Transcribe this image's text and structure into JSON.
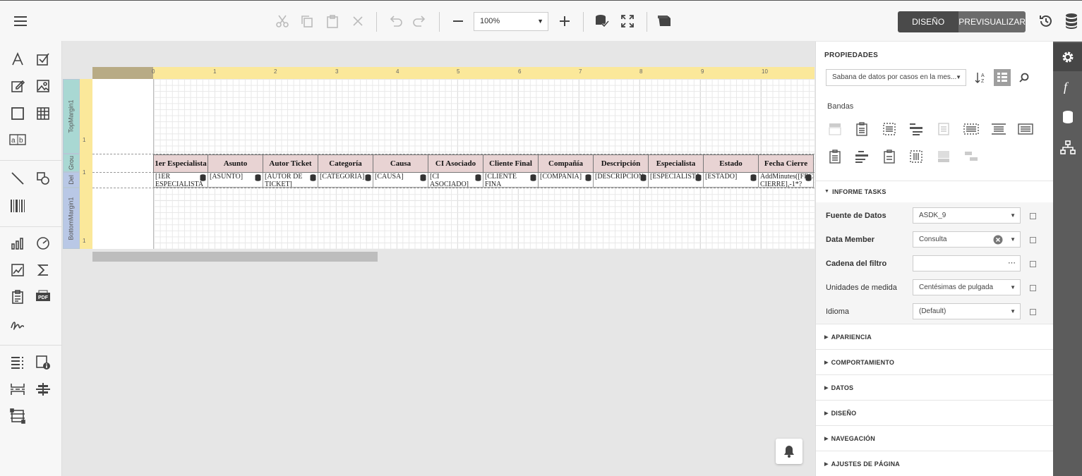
{
  "toolbar": {
    "zoom_value": "100%",
    "mode_design": "DISEÑO",
    "mode_preview": "PREVISUALIZAR",
    "icons": [
      "menu-icon",
      "cut-icon",
      "copy-icon",
      "paste-icon",
      "delete-icon",
      "undo-icon",
      "redo-icon",
      "zoom-out-icon",
      "zoom-in-icon",
      "validate-icon",
      "fullscreen-icon",
      "scripts-icon",
      "history-icon",
      "database-icon"
    ]
  },
  "toolbox": {
    "icons": [
      "label-icon",
      "checkbox-icon",
      "richtext-icon",
      "picture-icon",
      "panel-icon",
      "table-icon",
      "character-comb-icon",
      "line-icon",
      "shape-icon",
      "barcode-icon",
      "chart-icon",
      "gauge-icon",
      "sparkline-icon",
      "summary-icon",
      "subreport-icon",
      "pdf-icon",
      "signature-icon",
      "toc-icon",
      "page-info-icon",
      "page-break-icon",
      "cross-band-line-icon",
      "cross-band-box-icon"
    ]
  },
  "designer": {
    "ruler_numbers": [
      "0",
      "1",
      "2",
      "3",
      "4",
      "5",
      "6",
      "7",
      "8",
      "9",
      "10"
    ],
    "left_ruler_numbers": [
      "1",
      "1",
      "1"
    ],
    "bands": {
      "top_margin": "TopMargin1",
      "group": "Grou",
      "detail": "Del",
      "bottom_margin": "BottomMargin1"
    },
    "headers": [
      "1er Especialista",
      "Asunto",
      "Autor Ticket",
      "Categoría",
      "Causa",
      "CI Asociado",
      "Cliente Final",
      "Compañía",
      "Descripción",
      "Especialista",
      "Estado",
      "Fecha Cierre"
    ],
    "cells": [
      "[1ER ESPECIALISTA",
      "[ASUNTO]",
      "[AUTOR DE TICKET]",
      "[CATEGORIA]",
      "[CAUSA]",
      "[CI ASOCIADO]",
      "[CLIENTE FINA",
      "[COMPANIA]",
      "[DESCRIPCION",
      "[ESPECIALISTA",
      "[ESTADO]",
      "AddMinutes([FECHA CIERRE],-1*?"
    ]
  },
  "properties": {
    "title": "PROPIEDADES",
    "object_selector": "Sabana de datos por casos en la mes...",
    "bandas_label": "Bandas",
    "section_open": "INFORME TASKS",
    "rows": [
      {
        "label": "Fuente de Datos",
        "value": "ASDK_9",
        "bold": true
      },
      {
        "label": "Data Member",
        "value": "Consulta",
        "bold": true
      },
      {
        "label": "Cadena del filtro",
        "value": "",
        "bold": true
      },
      {
        "label": "Unidades de medida",
        "value": "Centésimas de pulgada",
        "bold": false
      },
      {
        "label": "Idioma",
        "value": "(Default)",
        "bold": false
      }
    ],
    "sections": [
      "APARIENCIA",
      "COMPORTAMIENTO",
      "DATOS",
      "DISEÑO",
      "NAVEGACIÓN",
      "AJUSTES DE PÁGINA"
    ]
  },
  "rightbar": {
    "icons": [
      "properties-gear-icon",
      "expressions-function-icon",
      "field-list-database-icon",
      "report-explorer-icon"
    ]
  },
  "colors": {
    "header_fill": "#e8d3d3",
    "ruler_yellow": "#fbe89a",
    "band_tab_top": "#a9d8d3",
    "band_tab_detail": "#b9c8e6",
    "rightbar": "#5c5c5c"
  }
}
